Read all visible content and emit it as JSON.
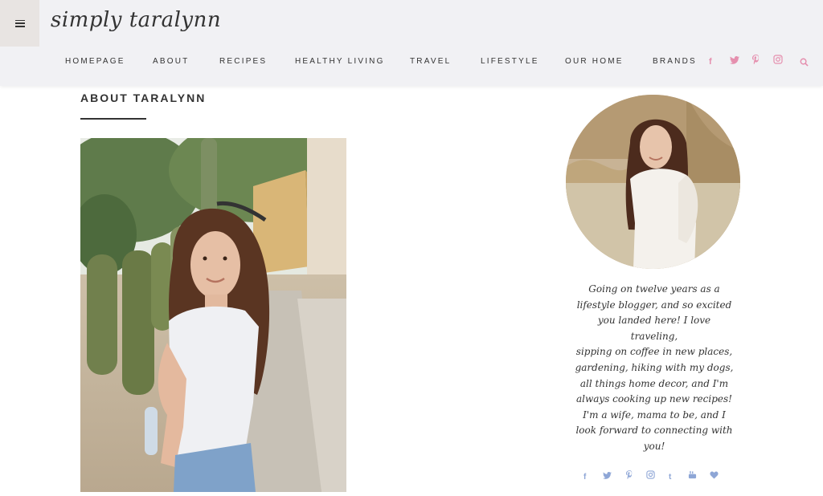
{
  "header": {
    "logo": "simply taralynn",
    "nav": [
      "HOMEPAGE",
      "ABOUT",
      "RECIPES",
      "HEALTHY LIVING",
      "TRAVEL",
      "LIFESTYLE",
      "OUR HOME",
      "BRANDS"
    ],
    "social_icons": [
      "facebook-icon",
      "twitter-icon",
      "pinterest-icon",
      "instagram-icon"
    ],
    "accent_color": "#e58fae"
  },
  "main": {
    "title": "ABOUT TARALYNN"
  },
  "sidebar": {
    "bio_lines": [
      "Going on twelve years as a",
      "lifestyle blogger, and so excited",
      "you landed here! I love traveling,",
      "sipping on coffee in new places,",
      "gardening, hiking with my dogs,",
      "all things home decor, and I'm",
      "always cooking up new recipes!",
      "I'm a wife, mama to be, and I",
      "look forward to connecting with",
      "you!"
    ],
    "social_icons": [
      "facebook-icon",
      "twitter-icon",
      "pinterest-icon",
      "instagram-icon",
      "tumblr-icon",
      "youtube-icon",
      "heart-icon"
    ],
    "social_color": "#8ea6d6"
  }
}
